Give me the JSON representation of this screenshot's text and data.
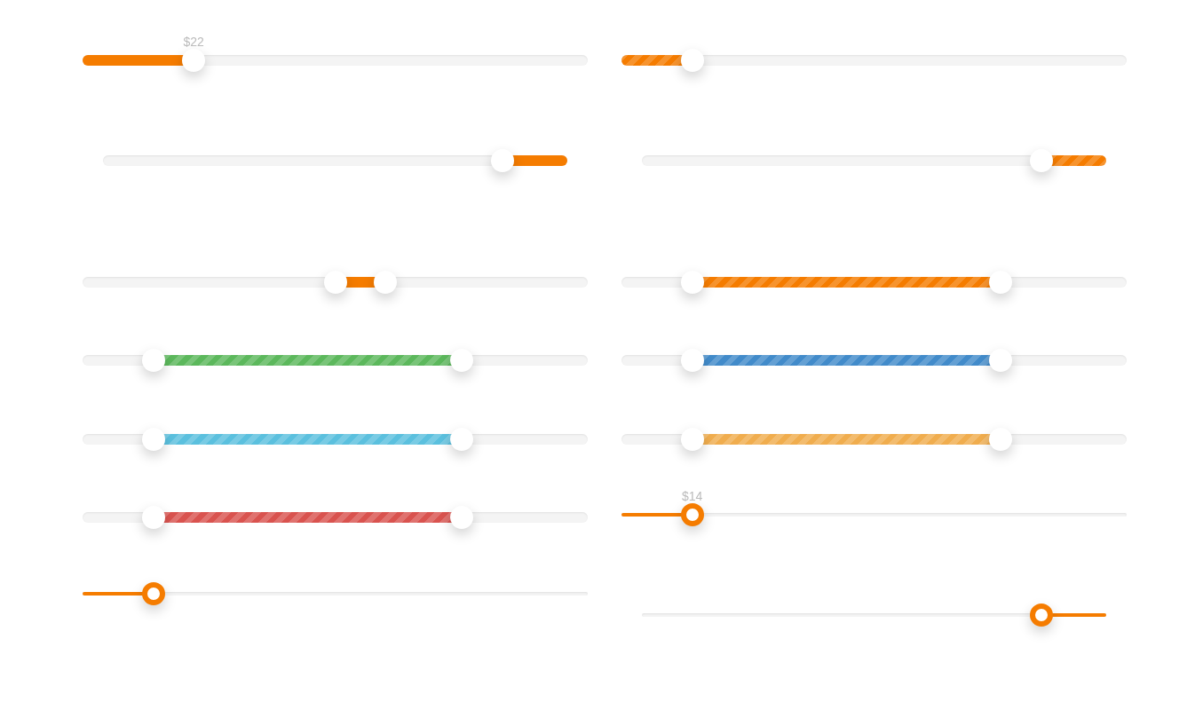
{
  "columns": [
    {
      "sliders": [
        {
          "kind": "single",
          "color": "#f57c00",
          "striped": false,
          "level": 0.22,
          "label": "$22"
        },
        {
          "kind": "reverse",
          "color": "#f57c00",
          "striped": false,
          "level": 0.14
        },
        {
          "kind": "range",
          "color": "#f57c00",
          "striped": false,
          "handles": [
            {
              "level": 0.5
            },
            {
              "level": 0.6
            }
          ]
        },
        {
          "kind": "range",
          "color": "#5cb85c",
          "striped": true,
          "handles": [
            {
              "level": 0.14
            },
            {
              "level": 0.75
            }
          ]
        },
        {
          "kind": "range",
          "color": "#5bc0de",
          "striped": true,
          "handles": [
            {
              "level": 0.14
            },
            {
              "level": 0.75
            }
          ]
        },
        {
          "kind": "range",
          "color": "#d9534f",
          "striped": true,
          "handles": [
            {
              "level": 0.14
            },
            {
              "level": 0.75
            }
          ]
        },
        {
          "kind": "thin",
          "color": "#f57c00",
          "striped": false,
          "level": 0.14
        }
      ]
    },
    {
      "sliders": [
        {
          "kind": "single",
          "color": "#f57c00",
          "striped": true,
          "level": 0.14
        },
        {
          "kind": "reverse",
          "color": "#f57c00",
          "striped": true,
          "level": 0.14
        },
        {
          "kind": "range",
          "color": "#f57c00",
          "striped": true,
          "handles": [
            {
              "level": 0.14
            },
            {
              "level": 0.75
            }
          ]
        },
        {
          "kind": "range",
          "color": "#428bca",
          "striped": true,
          "handles": [
            {
              "level": 0.14
            },
            {
              "level": 0.75
            }
          ]
        },
        {
          "kind": "range",
          "color": "#f0ad4e",
          "striped": true,
          "handles": [
            {
              "level": 0.14
            },
            {
              "level": 0.75
            }
          ]
        },
        {
          "kind": "thin",
          "color": "#f57c00",
          "striped": false,
          "level": 0.14,
          "label": "$14"
        },
        {
          "kind": "thin-reverse",
          "color": "#f57c00",
          "striped": false,
          "level": 0.14
        }
      ]
    }
  ]
}
